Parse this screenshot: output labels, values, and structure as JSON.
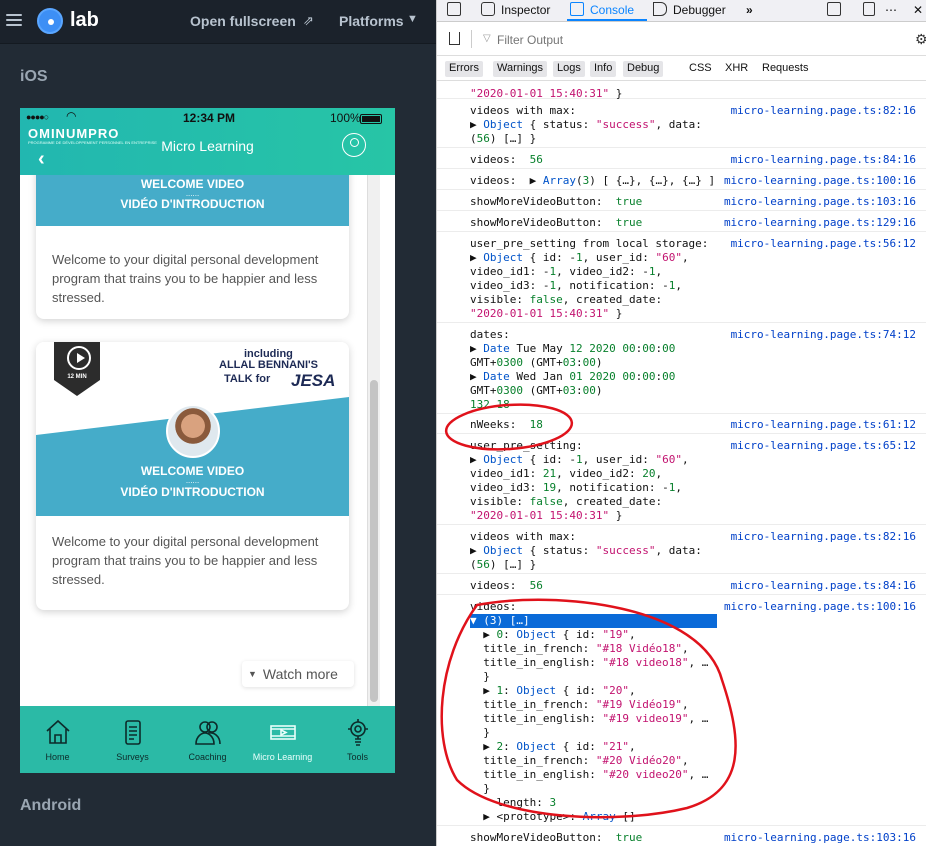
{
  "lab": {
    "logo_text": "lab",
    "open_fullscreen": "Open fullscreen",
    "platforms": "Platforms",
    "ios_label": "iOS",
    "android_label": "Android"
  },
  "phone": {
    "status": {
      "time": "12:34 PM",
      "battery": "100%"
    },
    "header": {
      "brand": "OMINUMPRO",
      "brand_sub": "PROGRAMME DE DÉVELOPPEMENT PERSONNEL EN ENTREPRISE",
      "title": "Micro Learning"
    },
    "cards": [
      {
        "banner_line1": "WELCOME VIDEO",
        "dots": "......",
        "banner_line2": "VIDÉO D'INTRODUCTION",
        "description": "Welcome to your digital personal development program that trains you to be happier and less stressed."
      },
      {
        "duration": "12 MIN",
        "including": "including",
        "speaker": "ALLAL BENNANI'S",
        "talk_for": "TALK for",
        "company": "JESA",
        "banner_line1": "WELCOME VIDEO",
        "dots": "......",
        "banner_line2": "VIDÉO D'INTRODUCTION",
        "description": "Welcome to your digital personal development program that trains you to be happier and less stressed."
      }
    ],
    "watch_more": "Watch more",
    "tabs": [
      {
        "label": "Home",
        "icon": "home-icon"
      },
      {
        "label": "Surveys",
        "icon": "clipboard-icon"
      },
      {
        "label": "Coaching",
        "icon": "people-icon"
      },
      {
        "label": "Micro Learning",
        "icon": "video-icon",
        "active": true
      },
      {
        "label": "Tools",
        "icon": "lightbulb-gear-icon"
      }
    ]
  },
  "devtools": {
    "tabs": [
      "Inspector",
      "Console",
      "Debugger"
    ],
    "active_tab": "Console",
    "filter_placeholder": "Filter Output",
    "categories": [
      "Errors",
      "Warnings",
      "Logs",
      "Info",
      "Debug"
    ],
    "extra_filters": [
      "CSS",
      "XHR",
      "Requests"
    ],
    "log": [
      {
        "lines": [
          "\"2020-01-01 15:40:31\" }"
        ],
        "src": ""
      },
      {
        "lines": [
          "videos with max:",
          "▶ Object { status: \"success\", data:",
          "(56) […] }"
        ],
        "src": "micro-learning.page.ts:82:16"
      },
      {
        "lines": [
          "videos:  56"
        ],
        "src": "micro-learning.page.ts:84:16"
      },
      {
        "lines": [
          "videos:  ▶ Array(3) [ {…}, {…}, {…} ]"
        ],
        "src": "micro-learning.page.ts:100:16"
      },
      {
        "lines": [
          "showMoreVideoButton:  true"
        ],
        "src": "micro-learning.page.ts:103:16"
      },
      {
        "lines": [
          "showMoreVideoButton:  true"
        ],
        "src": "micro-learning.page.ts:129:16"
      },
      {
        "lines": [
          "user_pre_setting from local storage:",
          "▶ Object { id: -1, user_id: \"60\",",
          "video_id1: -1, video_id2: -1,",
          "video_id3: -1, notification: -1,",
          "visible: false, created_date:",
          "\"2020-01-01 15:40:31\" }"
        ],
        "src": "micro-learning.page.ts:56:12"
      },
      {
        "lines": [
          "dates:",
          "▶ Date Tue May 12 2020 00:00:00",
          "GMT+0300 (GMT+03:00)",
          "▶ Date Wed Jan 01 2020 00:00:00",
          "GMT+0300 (GMT+03:00)",
          "132 18"
        ],
        "src": "micro-learning.page.ts:74:12"
      },
      {
        "lines": [
          "nWeeks:  18"
        ],
        "src": "micro-learning.page.ts:61:12"
      },
      {
        "lines": [
          "user_pre_setting:",
          "▶ Object { id: -1, user_id: \"60\",",
          "video_id1: 21, video_id2: 20,",
          "video_id3: 19, notification: -1,",
          "visible: false, created_date:",
          "\"2020-01-01 15:40:31\" }"
        ],
        "src": "micro-learning.page.ts:65:12"
      },
      {
        "lines": [
          "videos with max:",
          "▶ Object { status: \"success\", data:",
          "(56) […] }"
        ],
        "src": "micro-learning.page.ts:82:16"
      },
      {
        "lines": [
          "videos:  56"
        ],
        "src": "micro-learning.page.ts:84:16"
      },
      {
        "lines": [
          "videos:",
          "▼ (3) […]",
          "  ▶ 0: Object { id: \"19\",",
          "  title_in_french: \"#18 Vidéo18\",",
          "  title_in_english: \"#18 video18\", …",
          "  }",
          "  ▶ 1: Object { id: \"20\",",
          "  title_in_french: \"#19 Vidéo19\",",
          "  title_in_english: \"#19 video19\", …",
          "  }",
          "  ▶ 2: Object { id: \"21\",",
          "  title_in_french: \"#20 Vidéo20\",",
          "  title_in_english: \"#20 video20\", …",
          "  }",
          "    length: 3",
          "  ▶ <prototype>: Array []"
        ],
        "src": "micro-learning.page.ts:100:16"
      },
      {
        "lines": [
          "showMoreVideoButton:  true"
        ],
        "src": "micro-learning.page.ts:103:16"
      }
    ]
  },
  "colors": {
    "annotation": "#e0121b",
    "teal": "#2bbaa6",
    "banner_blue": "#45acc9",
    "lab_bg": "#222b35"
  }
}
